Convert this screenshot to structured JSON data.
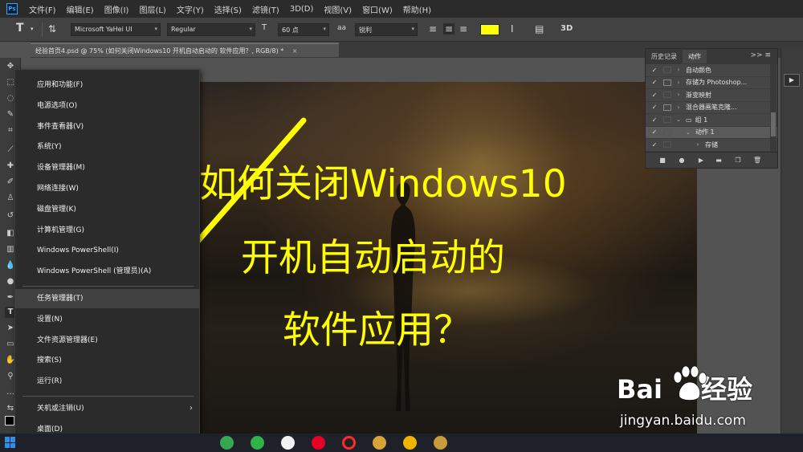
{
  "app": {
    "logo": "Ps",
    "menus": [
      "文件(F)",
      "编辑(E)",
      "图像(I)",
      "图层(L)",
      "文字(Y)",
      "选择(S)",
      "滤镜(T)",
      "3D(D)",
      "视图(V)",
      "窗口(W)",
      "帮助(H)"
    ]
  },
  "options_bar": {
    "font_family": "Microsoft YaHei UI",
    "font_style": "Regular",
    "font_size": "60 点",
    "aa_icon": "aa",
    "anti_alias": "锐利",
    "text_color": "#ffff00",
    "label_3d": "3D"
  },
  "document": {
    "tab_title": "经验首页4.psd @ 75% (如何关闭Windows10 开机自动启动的 软件应用？, RGB/8) *",
    "close_glyph": "×"
  },
  "canvas": {
    "title_lines": [
      "如何关闭Windows10",
      "开机自动启动的",
      "软件应用？"
    ],
    "title_color": "#ffff00"
  },
  "panel": {
    "tabs": [
      "历史记录",
      "动作"
    ],
    "menu_glyph": ">> ≡",
    "rows": [
      {
        "label": "自动颜色",
        "dialog": false,
        "indent": 0,
        "expander": "›"
      },
      {
        "label": "存储为 Photoshop...",
        "dialog": true,
        "indent": 0,
        "expander": "›"
      },
      {
        "label": "渐变映射",
        "dialog": false,
        "indent": 0,
        "expander": "›"
      },
      {
        "label": "混合器画笔克隆...",
        "dialog": true,
        "indent": 0,
        "expander": "›"
      },
      {
        "label": "组 1",
        "dialog": false,
        "indent": 0,
        "expander": "⌄"
      },
      {
        "label": "动作 1",
        "dialog": false,
        "indent": 1,
        "expander": "⌄"
      },
      {
        "label": "存储",
        "dialog": false,
        "indent": 2,
        "expander": "›"
      }
    ]
  },
  "winx_menu": {
    "groups": [
      [
        "应用和功能(F)",
        "电源选项(O)",
        "事件查看器(V)",
        "系统(Y)",
        "设备管理器(M)",
        "网络连接(W)",
        "磁盘管理(K)",
        "计算机管理(G)",
        "Windows PowerShell(I)",
        "Windows PowerShell (管理员)(A)"
      ],
      [
        "任务管理器(T)",
        "设置(N)",
        "文件资源管理器(E)",
        "搜索(S)",
        "运行(R)"
      ],
      [
        "关机或注销(U)",
        "桌面(D)"
      ]
    ],
    "highlighted": "任务管理器(T)",
    "submenu_arrow": "›",
    "arrow_color": "#ffff00"
  },
  "taskbar": {
    "apps": [
      {
        "name": "play-store-icon",
        "color": "#34a853"
      },
      {
        "name": "360-browser-icon",
        "color": "#2db34a"
      },
      {
        "name": "white-circle-app-icon",
        "color": "#f2f2f2"
      },
      {
        "name": "netease-music-icon",
        "color": "#e60026"
      },
      {
        "name": "record-app-icon",
        "color": "#222222"
      },
      {
        "name": "paint-palette-icon",
        "color": "#d9a23a"
      },
      {
        "name": "g-app-icon",
        "color": "#f0b400"
      },
      {
        "name": "game-app-icon",
        "color": "#c89b3c"
      }
    ]
  },
  "watermark": {
    "brand_left": "Bai",
    "brand_right": "经验",
    "url": "jingyan.baidu.com"
  }
}
